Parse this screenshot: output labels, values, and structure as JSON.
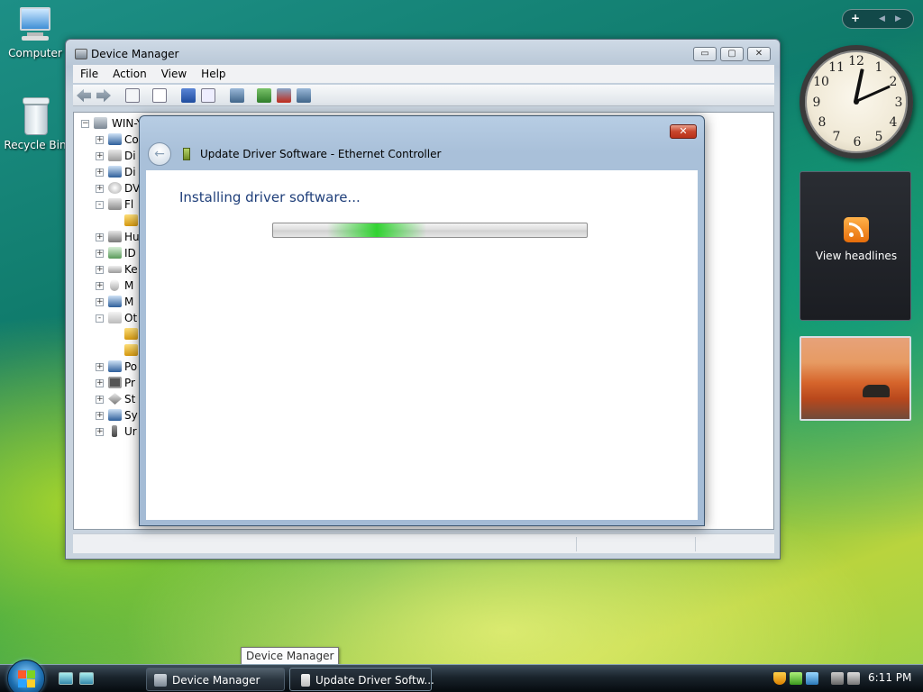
{
  "desktop": {
    "icons": [
      {
        "label": "Computer"
      },
      {
        "label": "Recycle Bin"
      }
    ]
  },
  "sidebar": {
    "controls": {
      "add": "+",
      "prev": "◀",
      "next": "▶"
    },
    "clock": {
      "numbers": [
        "12",
        "1",
        "2",
        "3",
        "4",
        "5",
        "6",
        "7",
        "8",
        "9",
        "10",
        "11"
      ]
    },
    "feed": {
      "label": "View headlines"
    }
  },
  "device_manager": {
    "title": "Device Manager",
    "window_buttons": {
      "minimize": "▭",
      "maximize": "▢",
      "close": "✕"
    },
    "menu": [
      "File",
      "Action",
      "View",
      "Help"
    ],
    "tree": {
      "root": "WIN-Y",
      "items": [
        {
          "label": "Co",
          "exp": "+"
        },
        {
          "label": "Di",
          "exp": "+"
        },
        {
          "label": "Di",
          "exp": "+"
        },
        {
          "label": "DV",
          "exp": "+"
        },
        {
          "label": "Fl",
          "exp": "-"
        },
        {
          "label": "",
          "exp": ""
        },
        {
          "label": "Hu",
          "exp": "+"
        },
        {
          "label": "ID",
          "exp": "+"
        },
        {
          "label": "Ke",
          "exp": "+"
        },
        {
          "label": "M",
          "exp": "+"
        },
        {
          "label": "M",
          "exp": "+"
        },
        {
          "label": "Ot",
          "exp": "-"
        },
        {
          "label": "",
          "exp": ""
        },
        {
          "label": "",
          "exp": ""
        },
        {
          "label": "Po",
          "exp": "+"
        },
        {
          "label": "Pr",
          "exp": "+"
        },
        {
          "label": "St",
          "exp": "+"
        },
        {
          "label": "Sy",
          "exp": "+"
        },
        {
          "label": "Ur",
          "exp": "+"
        }
      ]
    }
  },
  "dialog": {
    "title": "Update Driver Software - Ethernet Controller",
    "close": "✕",
    "back": "←",
    "heading": "Installing driver software...",
    "progress": {
      "state": "indeterminate"
    }
  },
  "tooltip": {
    "text": "Device Manager"
  },
  "taskbar": {
    "buttons": [
      {
        "label": "Device Manager"
      },
      {
        "label": "Update Driver Softw..."
      }
    ],
    "clock": "6:11 PM"
  },
  "colors": {
    "dialog_heading": "#1f3f7a",
    "close_red": "#c8452b",
    "progress_green": "#28d228"
  }
}
